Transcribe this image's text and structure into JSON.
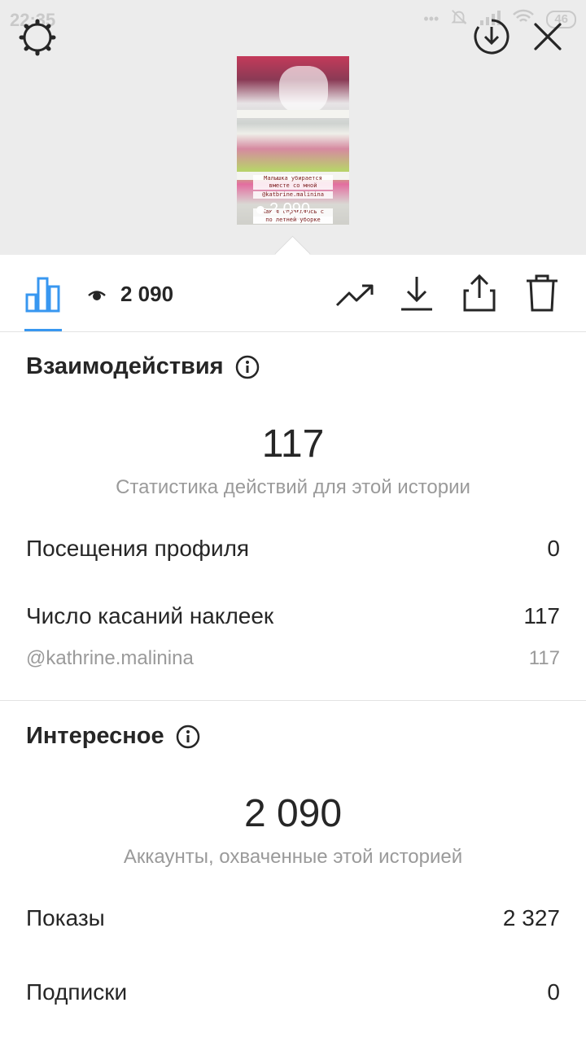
{
  "status_bar": {
    "time": "22:35",
    "battery": "46"
  },
  "story": {
    "caption_line1": "Малышка убирается",
    "caption_line2": "вместе со мной",
    "caption_handle": "@katbrine.malinina",
    "caption_line3": "Как я справляюсь с детьми",
    "caption_line4": "по летней уборке",
    "views_overlay": "2 090"
  },
  "toolbar": {
    "view_count": "2 090"
  },
  "interactions": {
    "title": "Взаимодействия",
    "total": "117",
    "total_caption": "Статистика действий для этой истории",
    "rows": [
      {
        "label": "Посещения профиля",
        "value": "0"
      },
      {
        "label": "Число касаний наклеек",
        "value": "117"
      }
    ],
    "sub_row": {
      "label": "@kathrine.malinina",
      "value": "117"
    }
  },
  "discovery": {
    "title": "Интересное",
    "total": "2 090",
    "total_caption": "Аккаунты, охваченные этой историей",
    "rows": [
      {
        "label": "Показы",
        "value": "2 327"
      },
      {
        "label": "Подписки",
        "value": "0"
      }
    ]
  },
  "colors": {
    "accent": "#3897f0",
    "text": "#262626",
    "muted": "#9a9a9a",
    "background_top": "#ececec"
  },
  "icons": [
    "settings-gear-icon",
    "download-circle-icon",
    "close-icon",
    "bar-chart-icon",
    "eye-icon",
    "trend-icon",
    "download-icon",
    "share-icon",
    "trash-icon",
    "info-icon"
  ]
}
